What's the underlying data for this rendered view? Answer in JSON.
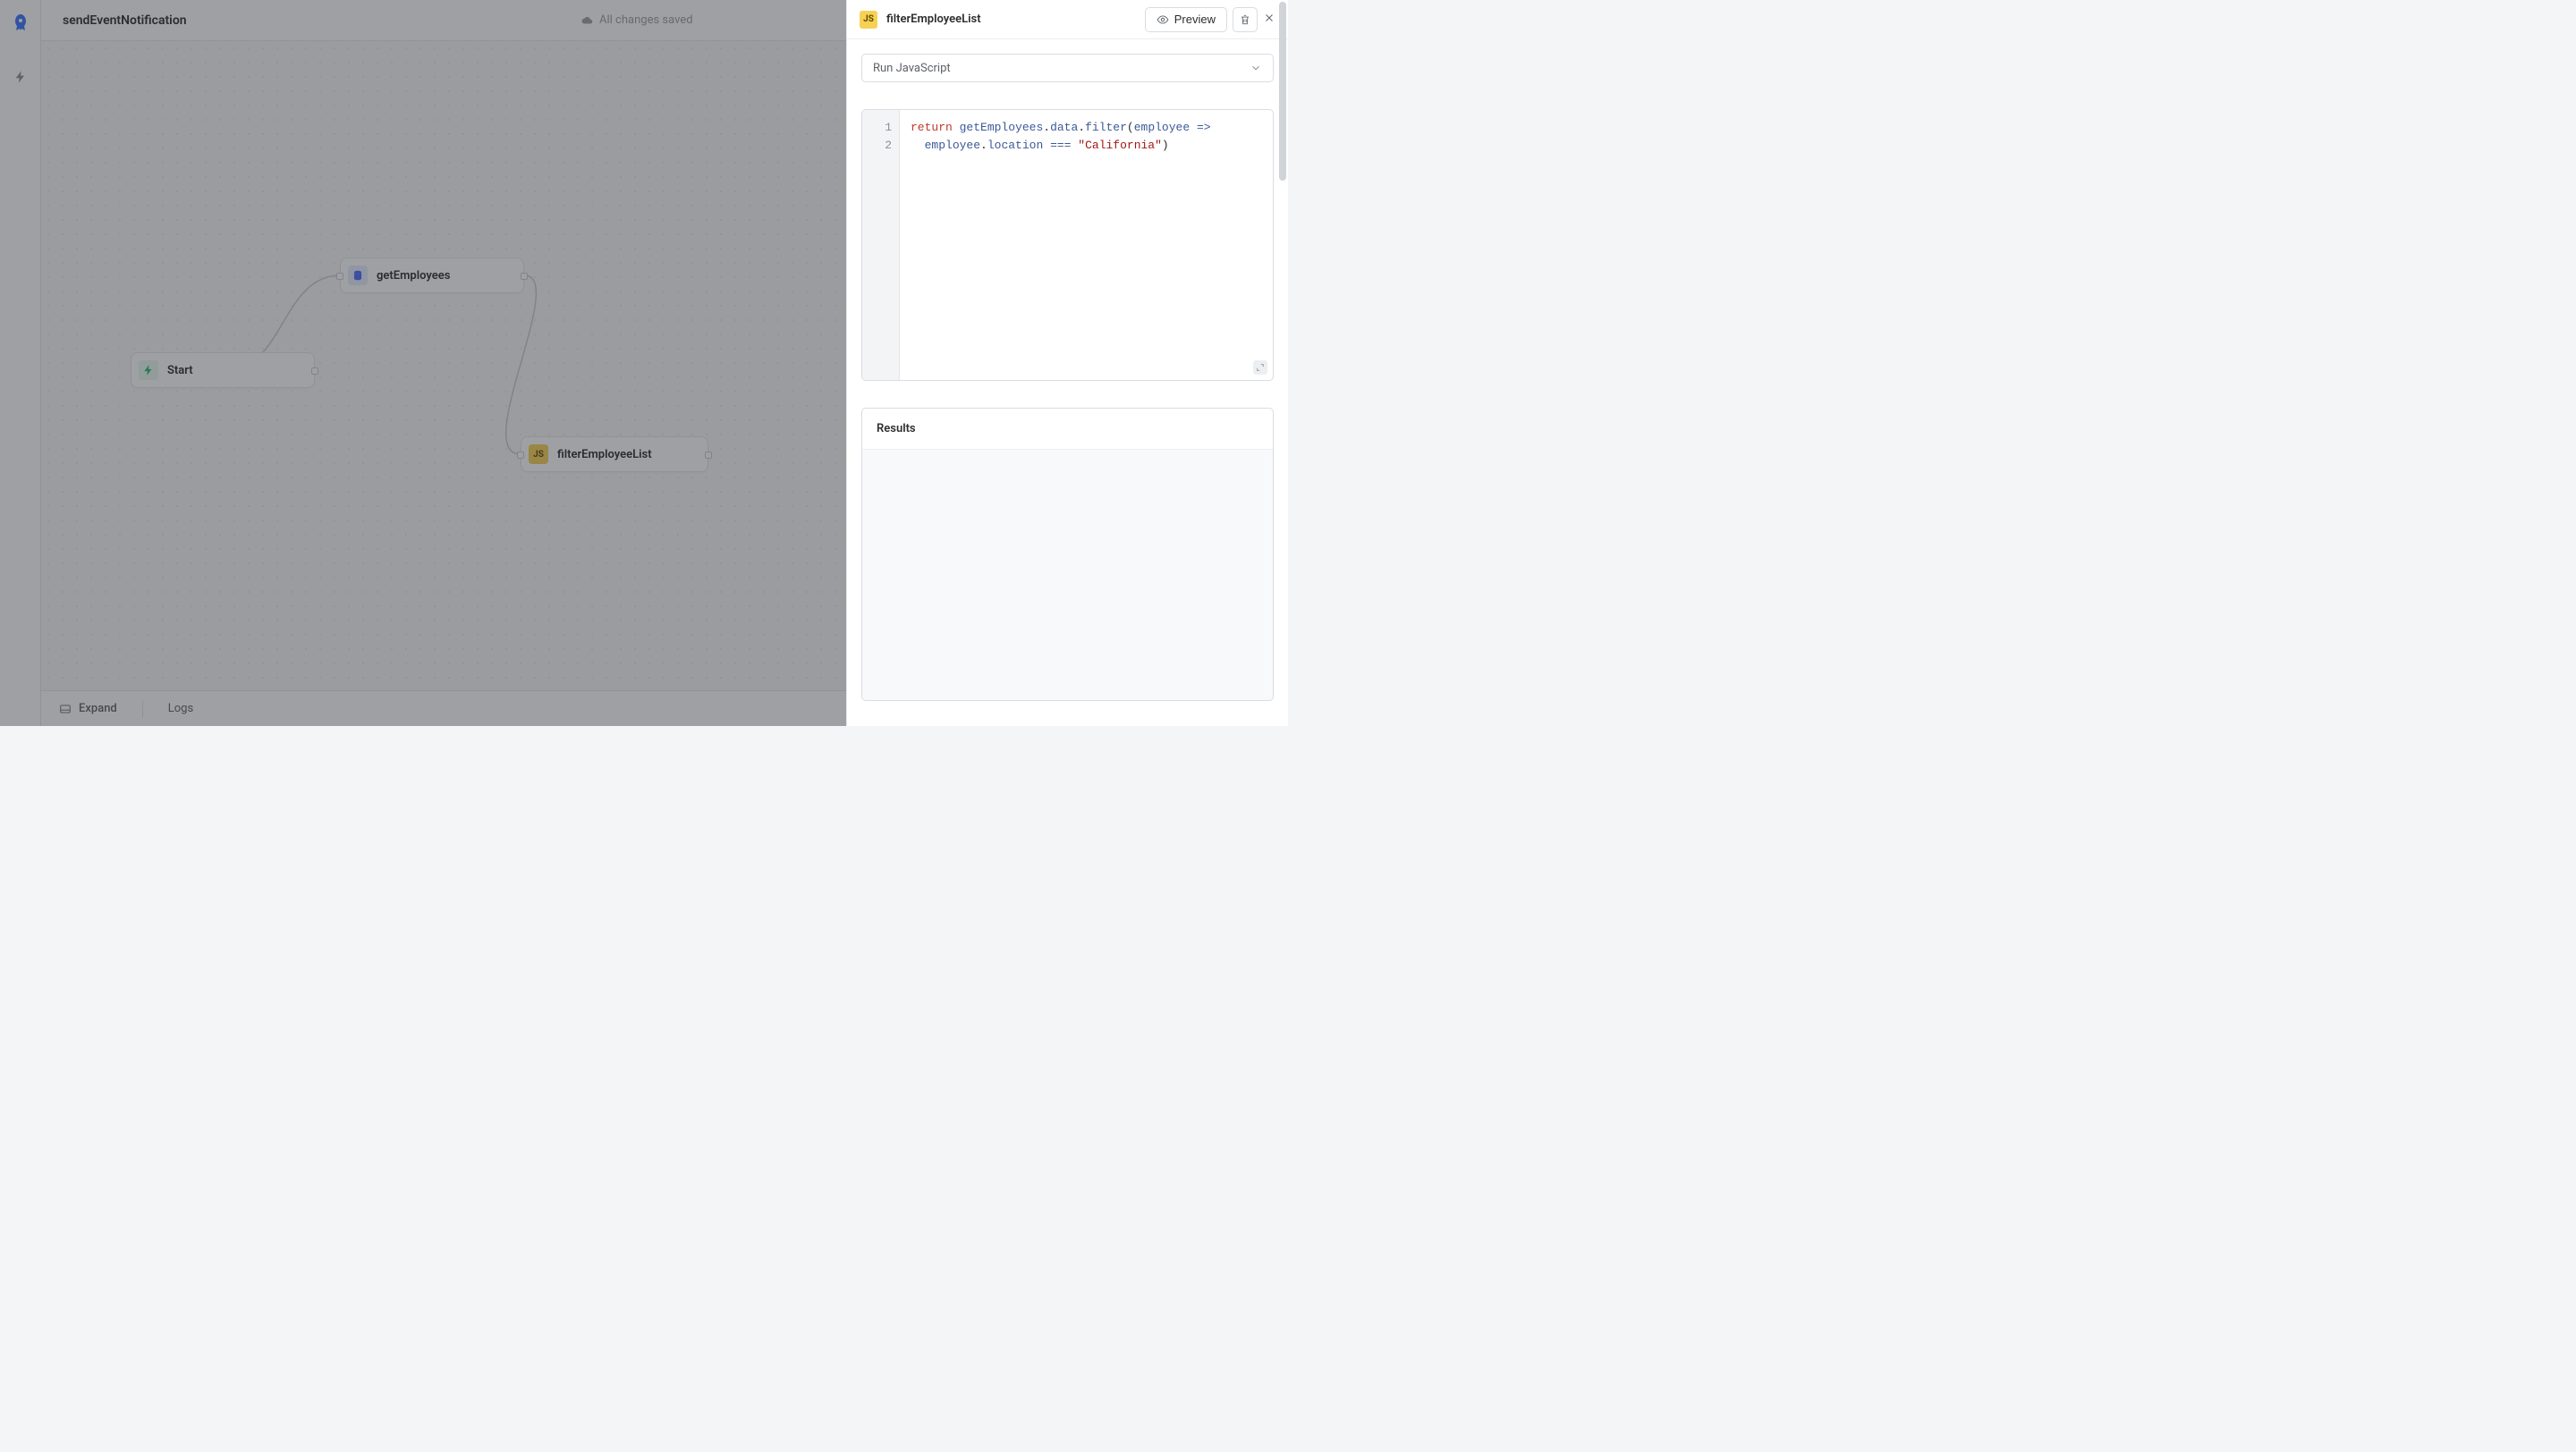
{
  "header": {
    "flow_title": "sendEventNotification",
    "save_status": "All changes saved"
  },
  "canvas": {
    "nodes": {
      "start": {
        "label": "Start"
      },
      "getEmployees": {
        "label": "getEmployees"
      },
      "filterEmployeeList": {
        "label": "filterEmployeeList"
      }
    }
  },
  "bottombar": {
    "expand_label": "Expand",
    "logs_label": "Logs"
  },
  "panel": {
    "title": "filterEmployeeList",
    "js_badge": "JS",
    "preview_label": "Preview",
    "type_select": "Run JavaScript",
    "code_lines": [
      "1",
      "2"
    ],
    "code": {
      "l1_return": "return",
      "l1_getEmployees": "getEmployees",
      "l1_data": "data",
      "l1_filter": "filter",
      "l1_employee": "employee",
      "l2_employee": "employee",
      "l2_location": "location",
      "l2_eq": "===",
      "l2_string": "\"California\""
    },
    "results_label": "Results"
  },
  "icons": {
    "rocket": "rocket-icon",
    "bolt": "bolt-icon",
    "cloud": "cloud-icon",
    "eye": "eye-icon",
    "trash": "trash-icon",
    "close": "close-icon",
    "chevron_down": "chevron-down-icon",
    "db": "database-icon",
    "panel": "panel-icon",
    "zoom_in": "zoom-in-icon",
    "zoom_out": "zoom-out-icon",
    "fullscreen": "fullscreen-icon",
    "lock": "lock-icon",
    "expand_code": "expand-icon"
  }
}
